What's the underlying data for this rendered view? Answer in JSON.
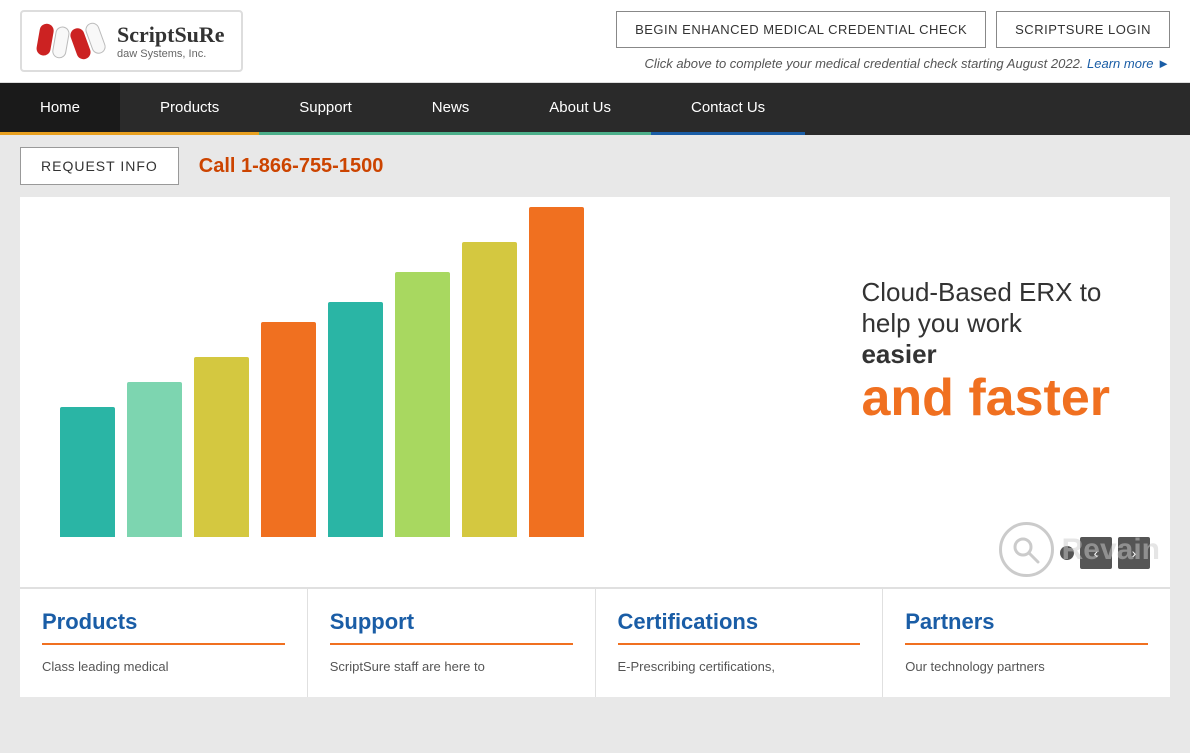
{
  "header": {
    "logo_brand": "ScriptSuRe",
    "logo_sub": "daw Systems, Inc.",
    "btn_credential": "BEGIN ENHANCED MEDICAL CREDENTIAL CHECK",
    "btn_login": "SCRIPTSURE LOGIN",
    "subtext": "Click above to complete your medical credential check starting August 2022.",
    "learn_more": "Learn more"
  },
  "nav": {
    "items": [
      {
        "label": "Home",
        "class": "home"
      },
      {
        "label": "Products",
        "class": "products"
      },
      {
        "label": "Support",
        "class": "support"
      },
      {
        "label": "News",
        "class": "news"
      },
      {
        "label": "About Us",
        "class": "aboutus"
      },
      {
        "label": "Contact Us",
        "class": "contactus"
      }
    ]
  },
  "action_bar": {
    "request_btn": "REQUEST INFO",
    "phone": "Call 1-866-755-1500"
  },
  "hero": {
    "text_line1": "Cloud-Based ERX to",
    "text_line2": "help you work",
    "text_line3": "easier",
    "text_line4": "and faster",
    "bars": [
      130,
      155,
      180,
      215,
      235,
      265,
      295,
      330
    ]
  },
  "cards": [
    {
      "title": "Products",
      "text": "Class leading medical"
    },
    {
      "title": "Support",
      "text": "ScriptSure staff are here to"
    },
    {
      "title": "Certifications",
      "text": "E-Prescribing certifications,"
    },
    {
      "title": "Partners",
      "text": "Our technology partners"
    }
  ],
  "slider": {
    "prev": "‹",
    "next": "›"
  }
}
